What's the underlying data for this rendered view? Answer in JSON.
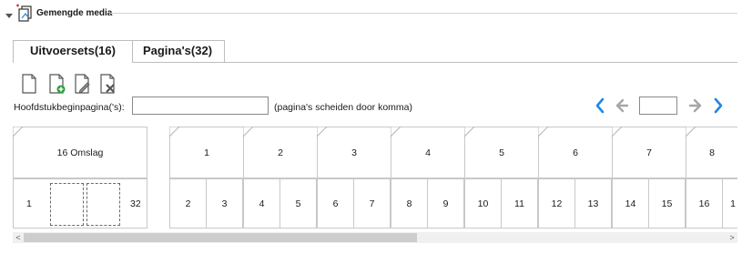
{
  "group": {
    "title": "Gemengde media",
    "toggle_icon": "caret-down-icon",
    "icon": "mixed-media-icon"
  },
  "tabs": [
    {
      "label": "Uitvoersets(16)",
      "active": true
    },
    {
      "label": "Pagina's(32)",
      "active": false
    }
  ],
  "toolbar": {
    "icons": [
      "new-document-icon",
      "add-document-icon",
      "edit-document-icon",
      "delete-document-icon"
    ]
  },
  "chapter": {
    "label": "Hoofdstukbeginpagina('s):",
    "value": "",
    "hint": "(pagina's scheiden door komma)"
  },
  "navigation": {
    "page_value": "",
    "icons": [
      "first-page-icon",
      "previous-page-icon",
      "next-page-icon",
      "last-page-icon"
    ]
  },
  "sets": {
    "cover_label": "16 Omslag",
    "cover_pages": [
      "1",
      "32"
    ],
    "set_labels": [
      "1",
      "2",
      "3",
      "4",
      "5",
      "6",
      "7",
      "8"
    ],
    "page_pairs": [
      [
        "2",
        "3"
      ],
      [
        "4",
        "5"
      ],
      [
        "6",
        "7"
      ],
      [
        "8",
        "9"
      ],
      [
        "10",
        "11"
      ],
      [
        "12",
        "13"
      ],
      [
        "14",
        "15"
      ],
      [
        "16",
        "1"
      ]
    ]
  },
  "colors": {
    "nav_active": "#1e88e5",
    "nav_disabled": "#a6a6a6",
    "border": "#c8c8c8",
    "doc_green": "#2e9e3e",
    "doc_red": "#c0392b"
  },
  "scrollbar": {
    "left_arrow": "<",
    "right_arrow": ">"
  }
}
